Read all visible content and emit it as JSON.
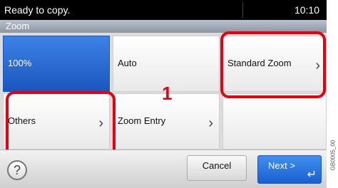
{
  "status_bar": {
    "message": "Ready to copy.",
    "time": "10:10"
  },
  "header": {
    "title": "Zoom"
  },
  "tiles": [
    {
      "label": "100%",
      "selected": true,
      "has_chevron": false
    },
    {
      "label": "Auto",
      "selected": false,
      "has_chevron": false
    },
    {
      "label": "Standard Zoom",
      "selected": false,
      "has_chevron": true
    },
    {
      "label": "Others",
      "selected": false,
      "has_chevron": true
    },
    {
      "label": "Zoom Entry",
      "selected": false,
      "has_chevron": true
    },
    {
      "label": "",
      "selected": false,
      "has_chevron": false
    }
  ],
  "callout_number": "1",
  "bottom": {
    "help_symbol": "?",
    "cancel_label": "Cancel",
    "next_label": "Next >",
    "enter_symbol": "↵"
  },
  "side_code": "GB0005_00",
  "colors": {
    "selected_tile": "#1a56bf",
    "callout": "#e60012",
    "next_button": "#1a5fd0"
  },
  "icons": [
    "help-icon",
    "chevron-right-icon",
    "enter-icon"
  ]
}
